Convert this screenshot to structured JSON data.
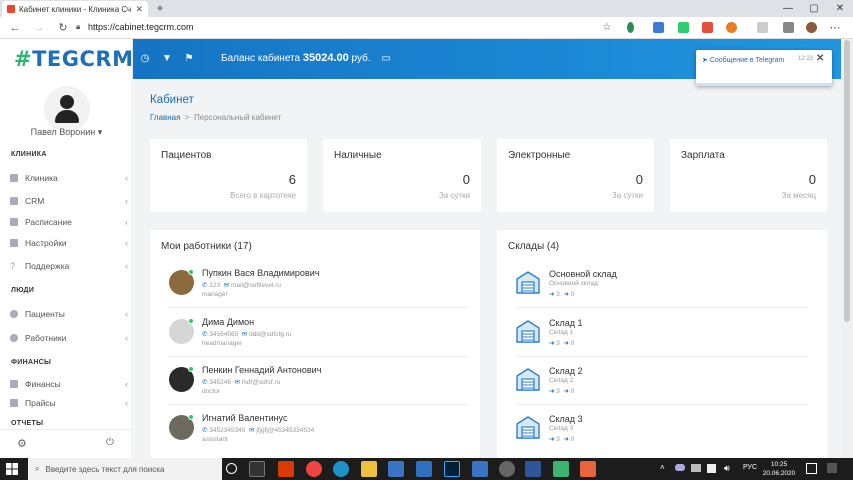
{
  "browser": {
    "tab_title": "Кабинет клиники - Клиника Сч",
    "tab_close": "✕",
    "new_tab": "+",
    "url": "https://cabinet.tegcrm.com",
    "window_buttons": [
      "—",
      "▢",
      "✕"
    ]
  },
  "logo": {
    "hash": "#",
    "text": "TEGCRM"
  },
  "user": {
    "name": "Павел Воронин"
  },
  "sidebar": {
    "sections": [
      {
        "title": "КЛИНИКА",
        "items": [
          {
            "label": "Клиника",
            "icon": "clinic-icon",
            "chevron": true
          },
          {
            "label": "CRM",
            "icon": "crm-icon",
            "chevron": true
          },
          {
            "label": "Расписание",
            "icon": "calendar-icon",
            "chevron": true
          },
          {
            "label": "Настройки",
            "icon": "settings-grid-icon",
            "chevron": true
          },
          {
            "label": "Поддержка",
            "icon": "question-icon",
            "chevron": true
          }
        ]
      },
      {
        "title": "ЛЮДИ",
        "items": [
          {
            "label": "Пациенты",
            "icon": "patient-icon",
            "chevron": true
          },
          {
            "label": "Работники",
            "icon": "worker-icon",
            "chevron": true
          }
        ]
      },
      {
        "title": "ФИНАНСЫ",
        "items": [
          {
            "label": "Финансы",
            "icon": "finance-icon",
            "chevron": true
          },
          {
            "label": "Прайсы",
            "icon": "price-icon",
            "chevron": true
          }
        ]
      },
      {
        "title": "ОТЧЕТЫ",
        "items": []
      }
    ]
  },
  "header": {
    "balance_label": "Баланс кабинета",
    "balance_value": "35024.00",
    "balance_currency": "руб."
  },
  "toast": {
    "message": "Сообщение в Telegram",
    "time": "12:23",
    "close": "✕"
  },
  "page": {
    "title": "Кабинет",
    "breadcrumb_home": "Главная",
    "breadcrumb_sep": ">",
    "breadcrumb_current": "Персональный кабинет"
  },
  "stats": [
    {
      "label": "Пациентов",
      "value": "6",
      "sub": "Всего в картотеке"
    },
    {
      "label": "Наличные",
      "value": "0",
      "sub": "За сутки"
    },
    {
      "label": "Электронные",
      "value": "0",
      "sub": "За сутки"
    },
    {
      "label": "Зарплата",
      "value": "0",
      "sub": "За месяц"
    }
  ],
  "workers": {
    "title": "Мои работники (17)",
    "items": [
      {
        "name": "Пупкин Вася Владимирович",
        "phone": "123",
        "email": "mail@softlevel.ru",
        "role": "manager"
      },
      {
        "name": "Дима Димон",
        "phone": "34564565",
        "email": "ddd@sdfsfg.ru",
        "role": "headmanager"
      },
      {
        "name": "Пенкин Геннадий Антонович",
        "phone": "345246",
        "email": "fsdf@sdfsf.ru",
        "role": "doctor"
      },
      {
        "name": "Игнатий Валентинус",
        "phone": "3452345345",
        "email": "jfjgfj@45345334534",
        "role": "assistant"
      }
    ]
  },
  "warehouses": {
    "title": "Склады (4)",
    "items": [
      {
        "name": "Основной склад",
        "sub": "Основной склад",
        "in": "3",
        "out": "0"
      },
      {
        "name": "Склад 1",
        "sub": "Склад 1",
        "in": "3",
        "out": "0"
      },
      {
        "name": "Склад 2",
        "sub": "Склад 2",
        "in": "3",
        "out": "0"
      },
      {
        "name": "Склад 3",
        "sub": "Склад 3",
        "in": "3",
        "out": "0"
      }
    ]
  },
  "taskbar": {
    "search_placeholder": "Введите здесь текст для поиска",
    "lang": "РУС",
    "time": "10:25",
    "date": "20.06.2020"
  }
}
